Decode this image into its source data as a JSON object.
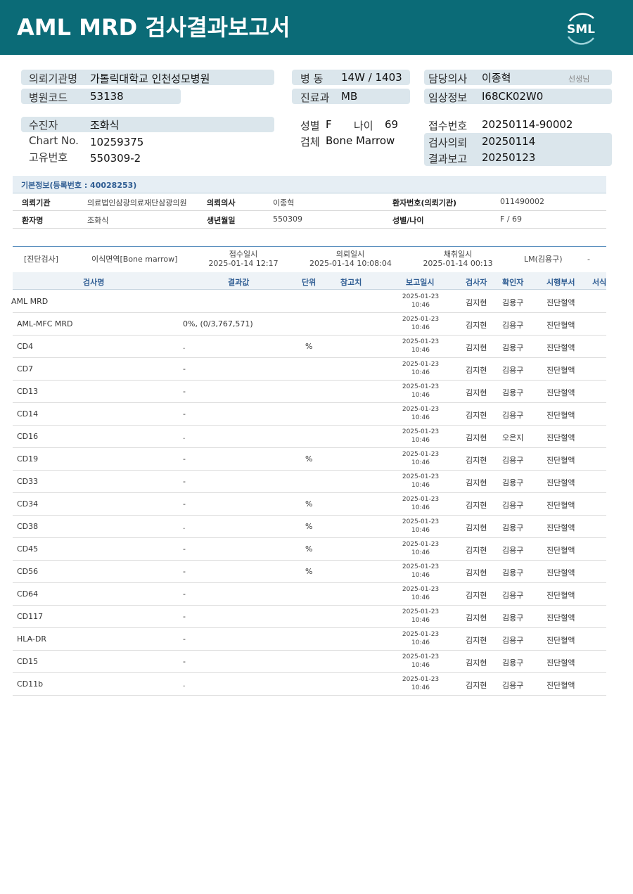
{
  "header": {
    "title": "AML MRD 검사결과보고서",
    "logo_text": "SML",
    "bg_color": "#0b6b77"
  },
  "info": {
    "institution_label": "의뢰기관명",
    "institution": "가톨릭대학교 인천성모병원",
    "hospital_code_label": "병원코드",
    "hospital_code": "53138",
    "ward_label": "병 동",
    "ward": "14W / 1403",
    "dept_label": "진료과",
    "dept": "MB",
    "doctor_label": "담당의사",
    "doctor": "이종혁",
    "doctor_suffix": "선생님",
    "clinical_label": "임상정보",
    "clinical": "I68CK02W0",
    "patient_label": "수진자",
    "patient": "조화식",
    "chart_label": "Chart No.",
    "chart": "10259375",
    "unique_label": "고유번호",
    "unique": "550309-2",
    "sex_label": "성별",
    "sex": "F",
    "age_label": "나이",
    "age": "69",
    "specimen_label": "검체",
    "specimen": "Bone Marrow",
    "receipt_label": "접수번호",
    "receipt": "20250114-90002",
    "request_label": "검사의뢰",
    "request": "20250114",
    "report_label": "결과보고",
    "report": "20250123"
  },
  "basic": {
    "header": "기본정보(등록번호 : 40028253)",
    "inst_label": "의뢰기관",
    "inst": "의료법인삼광의료재단삼광의원",
    "doctor_label": "의뢰의사",
    "doctor": "이종혁",
    "pid_label": "환자번호(의뢰기관)",
    "pid": "011490002",
    "name_label": "환자명",
    "name": "조화식",
    "birth_label": "생년월일",
    "birth": "550309",
    "sexage_label": "성별/나이",
    "sexage": "F / 69"
  },
  "specimen_info": {
    "category": "[진단검사]",
    "material": "이식면역[Bone marrow]",
    "receipt_label": "접수일시",
    "receipt": "2025-01-14 12:17",
    "request_label": "의뢰일시",
    "request": "2025-01-14 10:08:04",
    "collect_label": "채취일시",
    "collect": "2025-01-14 00:13",
    "lm": "LM(김용구)",
    "dash": "-"
  },
  "columns": {
    "name": "검사명",
    "result": "결과값",
    "unit": "단위",
    "ref": "참고치",
    "date": "보고일시",
    "tester": "검사자",
    "confirmer": "확인자",
    "dept": "시행부서",
    "format": "서식"
  },
  "rows": [
    {
      "name": "AML MRD",
      "result": "",
      "unit": "",
      "date": "2025-01-23",
      "time": "10:46",
      "tester": "김지현",
      "confirmer": "김용구",
      "dept": "진단혈액"
    },
    {
      "name": "AML-MFC MRD",
      "result": "0%, (0/3,767,571)",
      "unit": "",
      "date": "2025-01-23",
      "time": "10:46",
      "tester": "김지현",
      "confirmer": "김용구",
      "dept": "진단혈액"
    },
    {
      "name": "CD4",
      "result": ".",
      "unit": "%",
      "date": "2025-01-23",
      "time": "10:46",
      "tester": "김지현",
      "confirmer": "김용구",
      "dept": "진단혈액"
    },
    {
      "name": "CD7",
      "result": "-",
      "unit": "",
      "date": "2025-01-23",
      "time": "10:46",
      "tester": "김지현",
      "confirmer": "김용구",
      "dept": "진단혈액"
    },
    {
      "name": "CD13",
      "result": "-",
      "unit": "",
      "date": "2025-01-23",
      "time": "10:46",
      "tester": "김지현",
      "confirmer": "김용구",
      "dept": "진단혈액"
    },
    {
      "name": "CD14",
      "result": "-",
      "unit": "",
      "date": "2025-01-23",
      "time": "10:46",
      "tester": "김지현",
      "confirmer": "김용구",
      "dept": "진단혈액"
    },
    {
      "name": "CD16",
      "result": ".",
      "unit": "",
      "date": "2025-01-23",
      "time": "10:46",
      "tester": "김지현",
      "confirmer": "오은지",
      "dept": "진단혈액"
    },
    {
      "name": "CD19",
      "result": "-",
      "unit": "%",
      "date": "2025-01-23",
      "time": "10:46",
      "tester": "김지현",
      "confirmer": "김용구",
      "dept": "진단혈액"
    },
    {
      "name": "CD33",
      "result": "-",
      "unit": "",
      "date": "2025-01-23",
      "time": "10:46",
      "tester": "김지현",
      "confirmer": "김용구",
      "dept": "진단혈액"
    },
    {
      "name": "CD34",
      "result": "-",
      "unit": "%",
      "date": "2025-01-23",
      "time": "10:46",
      "tester": "김지현",
      "confirmer": "김용구",
      "dept": "진단혈액"
    },
    {
      "name": "CD38",
      "result": ".",
      "unit": "%",
      "date": "2025-01-23",
      "time": "10:46",
      "tester": "김지현",
      "confirmer": "김용구",
      "dept": "진단혈액"
    },
    {
      "name": "CD45",
      "result": "-",
      "unit": "%",
      "date": "2025-01-23",
      "time": "10:46",
      "tester": "김지현",
      "confirmer": "김용구",
      "dept": "진단혈액"
    },
    {
      "name": "CD56",
      "result": "-",
      "unit": "%",
      "date": "2025-01-23",
      "time": "10:46",
      "tester": "김지현",
      "confirmer": "김용구",
      "dept": "진단혈액"
    },
    {
      "name": "CD64",
      "result": "-",
      "unit": "",
      "date": "2025-01-23",
      "time": "10:46",
      "tester": "김지현",
      "confirmer": "김용구",
      "dept": "진단혈액"
    },
    {
      "name": "CD117",
      "result": "-",
      "unit": "",
      "date": "2025-01-23",
      "time": "10:46",
      "tester": "김지현",
      "confirmer": "김용구",
      "dept": "진단혈액"
    },
    {
      "name": "HLA-DR",
      "result": "-",
      "unit": "",
      "date": "2025-01-23",
      "time": "10:46",
      "tester": "김지현",
      "confirmer": "김용구",
      "dept": "진단혈액"
    },
    {
      "name": "CD15",
      "result": "-",
      "unit": "",
      "date": "2025-01-23",
      "time": "10:46",
      "tester": "김지현",
      "confirmer": "김용구",
      "dept": "진단혈액"
    },
    {
      "name": "CD11b",
      "result": ".",
      "unit": "",
      "date": "2025-01-23",
      "time": "10:46",
      "tester": "김지현",
      "confirmer": "김용구",
      "dept": "진단혈액"
    }
  ]
}
